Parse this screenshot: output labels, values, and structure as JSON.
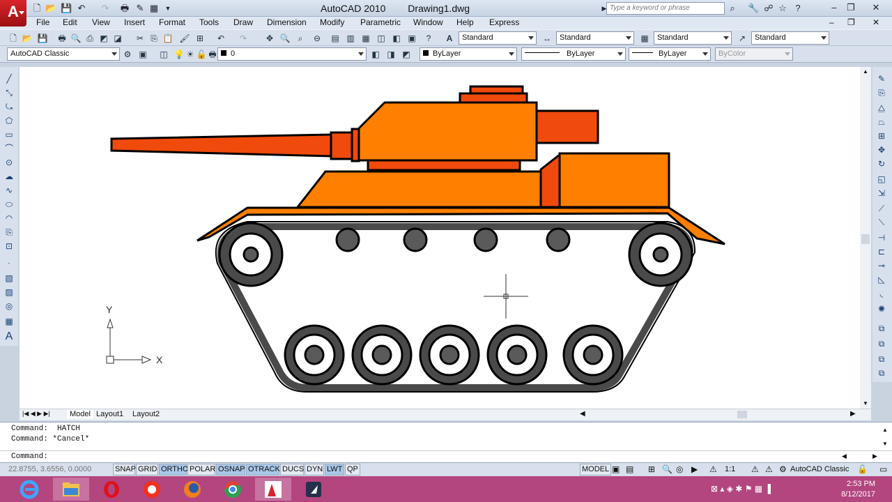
{
  "window": {
    "title": "AutoCAD 2010",
    "document": "Drawing1.dwg",
    "search_placeholder": "Type a keyword or phrase"
  },
  "menu": [
    "File",
    "Edit",
    "View",
    "Insert",
    "Format",
    "Tools",
    "Draw",
    "Dimension",
    "Modify",
    "Parametric",
    "Window",
    "Help",
    "Express"
  ],
  "styles": {
    "text_style": "Standard",
    "dim_style": "Standard",
    "table_style": "Standard",
    "multileader_style": "Standard"
  },
  "workspace": "AutoCAD Classic",
  "layer": "0",
  "properties": {
    "color": "ByLayer",
    "linetype": "ByLayer",
    "lineweight": "ByLayer",
    "plotstyle": "ByColor"
  },
  "ucs": {
    "y_label": "Y",
    "x_label": "X"
  },
  "layout_tabs": [
    "Model",
    "Layout1",
    "Layout2"
  ],
  "command_history": [
    "Command:  HATCH",
    "Command: *Cancel*"
  ],
  "command_prompt": "Command:",
  "coordinates": "22.8755, 3.6556, 0.0000",
  "status_toggles": [
    {
      "label": "SNAP",
      "on": false
    },
    {
      "label": "GRID",
      "on": false
    },
    {
      "label": "ORTHO",
      "on": true
    },
    {
      "label": "POLAR",
      "on": false
    },
    {
      "label": "OSNAP",
      "on": true
    },
    {
      "label": "OTRACK",
      "on": true
    },
    {
      "label": "DUCS",
      "on": false
    },
    {
      "label": "DYN",
      "on": false
    },
    {
      "label": "LWT",
      "on": true
    },
    {
      "label": "QP",
      "on": false
    }
  ],
  "status_right": {
    "model": "MODEL",
    "scale": "1:1",
    "workspace": "AutoCAD Classic"
  },
  "clock": {
    "time": "2:53 PM",
    "date": "8/12/2017"
  },
  "colors": {
    "tank_body": "#ff7f00",
    "tank_dark": "#f04a0c",
    "track": "#4a4a4a",
    "wheel_hub": "#5a5a5a"
  }
}
